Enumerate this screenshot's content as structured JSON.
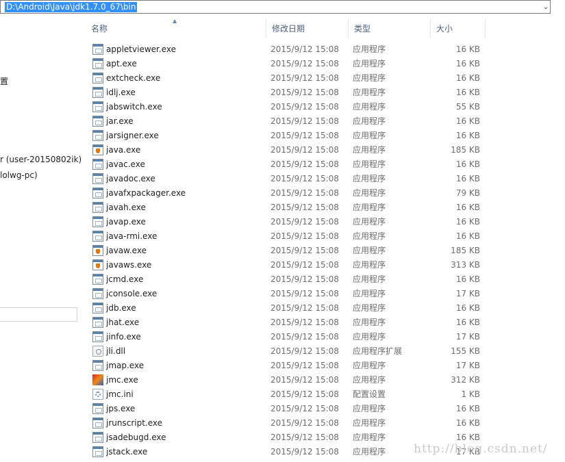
{
  "address_bar": {
    "path": "D:\\Android\\Java\\jdk1.7.0_67\\bin",
    "dropdown_icon": "chevron-down"
  },
  "nav_pane": {
    "items": [
      {
        "label": "置"
      },
      {
        "label": "r (user-20150802ik)"
      },
      {
        "label": "lolwg-pc)"
      }
    ]
  },
  "columns": {
    "name": "名称",
    "date": "修改日期",
    "type": "类型",
    "size": "大小"
  },
  "files": [
    {
      "name": "appletviewer.exe",
      "date": "2015/9/12 15:08",
      "type": "应用程序",
      "size": "16 KB",
      "icon": "exe"
    },
    {
      "name": "apt.exe",
      "date": "2015/9/12 15:08",
      "type": "应用程序",
      "size": "16 KB",
      "icon": "exe"
    },
    {
      "name": "extcheck.exe",
      "date": "2015/9/12 15:08",
      "type": "应用程序",
      "size": "16 KB",
      "icon": "exe"
    },
    {
      "name": "idlj.exe",
      "date": "2015/9/12 15:08",
      "type": "应用程序",
      "size": "16 KB",
      "icon": "exe"
    },
    {
      "name": "jabswitch.exe",
      "date": "2015/9/12 15:08",
      "type": "应用程序",
      "size": "55 KB",
      "icon": "exe"
    },
    {
      "name": "jar.exe",
      "date": "2015/9/12 15:08",
      "type": "应用程序",
      "size": "16 KB",
      "icon": "exe"
    },
    {
      "name": "jarsigner.exe",
      "date": "2015/9/12 15:08",
      "type": "应用程序",
      "size": "16 KB",
      "icon": "exe"
    },
    {
      "name": "java.exe",
      "date": "2015/9/12 15:08",
      "type": "应用程序",
      "size": "185 KB",
      "icon": "java"
    },
    {
      "name": "javac.exe",
      "date": "2015/9/12 15:08",
      "type": "应用程序",
      "size": "16 KB",
      "icon": "exe"
    },
    {
      "name": "javadoc.exe",
      "date": "2015/9/12 15:08",
      "type": "应用程序",
      "size": "16 KB",
      "icon": "exe"
    },
    {
      "name": "javafxpackager.exe",
      "date": "2015/9/12 15:08",
      "type": "应用程序",
      "size": "79 KB",
      "icon": "exe"
    },
    {
      "name": "javah.exe",
      "date": "2015/9/12 15:08",
      "type": "应用程序",
      "size": "16 KB",
      "icon": "exe"
    },
    {
      "name": "javap.exe",
      "date": "2015/9/12 15:08",
      "type": "应用程序",
      "size": "16 KB",
      "icon": "exe"
    },
    {
      "name": "java-rmi.exe",
      "date": "2015/9/12 15:08",
      "type": "应用程序",
      "size": "16 KB",
      "icon": "exe"
    },
    {
      "name": "javaw.exe",
      "date": "2015/9/12 15:08",
      "type": "应用程序",
      "size": "185 KB",
      "icon": "java"
    },
    {
      "name": "javaws.exe",
      "date": "2015/9/12 15:08",
      "type": "应用程序",
      "size": "313 KB",
      "icon": "java"
    },
    {
      "name": "jcmd.exe",
      "date": "2015/9/12 15:08",
      "type": "应用程序",
      "size": "16 KB",
      "icon": "exe"
    },
    {
      "name": "jconsole.exe",
      "date": "2015/9/12 15:08",
      "type": "应用程序",
      "size": "17 KB",
      "icon": "exe"
    },
    {
      "name": "jdb.exe",
      "date": "2015/9/12 15:08",
      "type": "应用程序",
      "size": "16 KB",
      "icon": "exe"
    },
    {
      "name": "jhat.exe",
      "date": "2015/9/12 15:08",
      "type": "应用程序",
      "size": "16 KB",
      "icon": "exe"
    },
    {
      "name": "jinfo.exe",
      "date": "2015/9/12 15:08",
      "type": "应用程序",
      "size": "17 KB",
      "icon": "exe"
    },
    {
      "name": "jli.dll",
      "date": "2015/9/12 15:08",
      "type": "应用程序扩展",
      "size": "155 KB",
      "icon": "dll"
    },
    {
      "name": "jmap.exe",
      "date": "2015/9/12 15:08",
      "type": "应用程序",
      "size": "17 KB",
      "icon": "exe"
    },
    {
      "name": "jmc.exe",
      "date": "2015/9/12 15:08",
      "type": "应用程序",
      "size": "312 KB",
      "icon": "jmc"
    },
    {
      "name": "jmc.ini",
      "date": "2015/9/12 15:08",
      "type": "配置设置",
      "size": "1 KB",
      "icon": "ini"
    },
    {
      "name": "jps.exe",
      "date": "2015/9/12 15:08",
      "type": "应用程序",
      "size": "16 KB",
      "icon": "exe"
    },
    {
      "name": "jrunscript.exe",
      "date": "2015/9/12 15:08",
      "type": "应用程序",
      "size": "16 KB",
      "icon": "exe"
    },
    {
      "name": "jsadebugd.exe",
      "date": "2015/9/12 15:08",
      "type": "应用程序",
      "size": "16 KB",
      "icon": "exe"
    },
    {
      "name": "jstack.exe",
      "date": "2015/9/12 15:08",
      "type": "应用程序",
      "size": "17 KB",
      "icon": "exe"
    }
  ],
  "watermark": "http://blog.csdn.net/"
}
